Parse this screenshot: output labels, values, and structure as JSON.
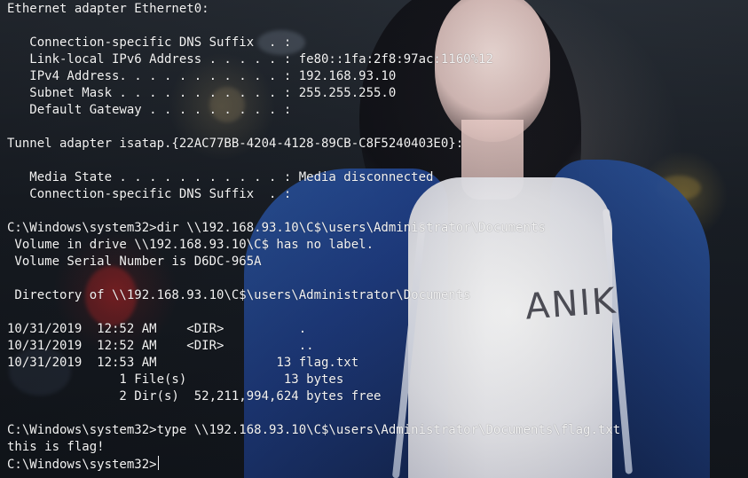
{
  "terminal": {
    "lines": [
      "Ethernet adapter Ethernet0:",
      "",
      "   Connection-specific DNS Suffix  . :",
      "   Link-local IPv6 Address . . . . . : fe80::1fa:2f8:97ac:1160%12",
      "   IPv4 Address. . . . . . . . . . . : 192.168.93.10",
      "   Subnet Mask . . . . . . . . . . . : 255.255.255.0",
      "   Default Gateway . . . . . . . . . :",
      "",
      "Tunnel adapter isatap.{22AC77BB-4204-4128-89CB-C8F5240403E0}:",
      "",
      "   Media State . . . . . . . . . . . : Media disconnected",
      "   Connection-specific DNS Suffix  . :",
      "",
      "C:\\Windows\\system32>dir \\\\192.168.93.10\\C$\\users\\Administrator\\Documents",
      " Volume in drive \\\\192.168.93.10\\C$ has no label.",
      " Volume Serial Number is D6DC-965A",
      "",
      " Directory of \\\\192.168.93.10\\C$\\users\\Administrator\\Documents",
      "",
      "10/31/2019  12:52 AM    <DIR>          .",
      "10/31/2019  12:52 AM    <DIR>          ..",
      "10/31/2019  12:53 AM                13 flag.txt",
      "               1 File(s)             13 bytes",
      "               2 Dir(s)  52,211,994,624 bytes free",
      "",
      "C:\\Windows\\system32>type \\\\192.168.93.10\\C$\\users\\Administrator\\Documents\\flag.txt",
      "this is flag!"
    ],
    "prompt": "C:\\Windows\\system32>"
  },
  "background": {
    "shirt_print": "ANIK",
    "accent_colors": {
      "jacket_blue": "#2f5fb3",
      "shirt_white": "#f2f2f6",
      "text": "#f3f3f3",
      "bokeh_red": "#ff3b3b",
      "bokeh_yellow": "#ffd35a"
    }
  }
}
